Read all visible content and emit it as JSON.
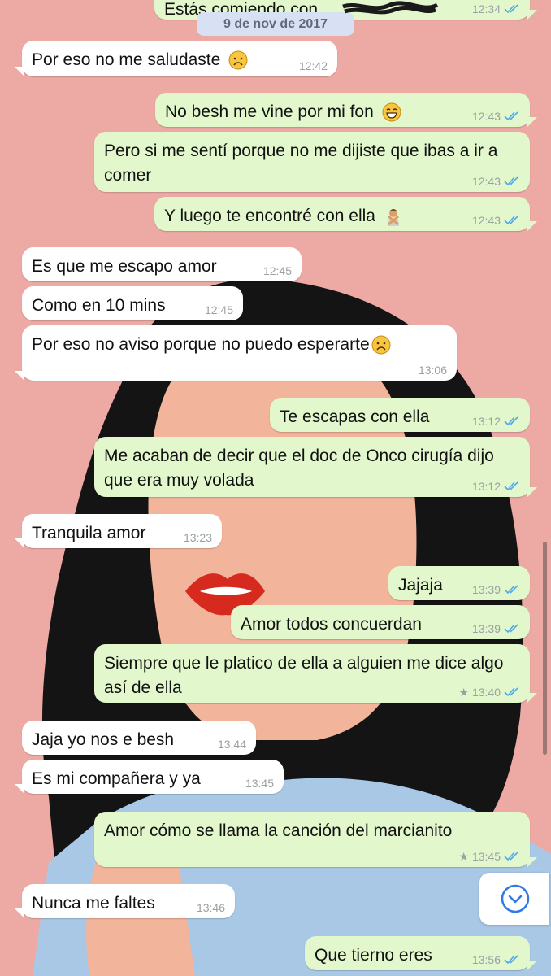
{
  "chat": {
    "date_label": "9 de nov de 2017",
    "messages": [
      {
        "dir": "out",
        "text": "Estás comiendo con",
        "time": "12:34",
        "status": "read"
      },
      {
        "dir": "in",
        "text": "Por eso no me saludaste",
        "emoji": "frowning-face",
        "time": "12:42"
      },
      {
        "dir": "out",
        "text": "No besh me vine por mi fon",
        "emoji": "grinning-face",
        "time": "12:43",
        "status": "read"
      },
      {
        "dir": "out",
        "text": "Pero si me sentí porque no me dijiste que ibas a ir a comer",
        "time": "12:43",
        "status": "read"
      },
      {
        "dir": "out",
        "text": "Y luego te encontré con ella",
        "emoji": "person-gesturing-no",
        "time": "12:43",
        "status": "read"
      },
      {
        "dir": "in",
        "text": "Es que me escapo amor",
        "time": "12:45"
      },
      {
        "dir": "in",
        "text": "Como en 10 mins",
        "time": "12:45"
      },
      {
        "dir": "in",
        "text": "Por eso no aviso porque no puedo esperarte",
        "emoji": "frowning-face",
        "time": "13:06"
      },
      {
        "dir": "out",
        "text": "Te escapas con ella",
        "time": "13:12",
        "status": "read"
      },
      {
        "dir": "out",
        "text": "Me acaban de decir que el doc de Onco cirugía dijo que era muy volada",
        "time": "13:12",
        "status": "read"
      },
      {
        "dir": "in",
        "text": "Tranquila amor",
        "time": "13:23"
      },
      {
        "dir": "out",
        "text": "Jajaja",
        "time": "13:39",
        "status": "read"
      },
      {
        "dir": "out",
        "text": "Amor todos concuerdan",
        "time": "13:39",
        "status": "read"
      },
      {
        "dir": "out",
        "text": "Siempre que le platico de ella a alguien me dice algo así de ella",
        "time": "13:40",
        "status": "read",
        "starred": true
      },
      {
        "dir": "in",
        "text": "Jaja yo nos e besh",
        "time": "13:44"
      },
      {
        "dir": "in",
        "text": "Es mi compañera y ya",
        "time": "13:45"
      },
      {
        "dir": "out",
        "text": "Amor cómo se llama la canción del marcianito",
        "time": "13:45",
        "status": "read",
        "starred": true
      },
      {
        "dir": "in",
        "text": "Nunca me faltes",
        "time": "13:46"
      },
      {
        "dir": "out",
        "text": "Que tierno eres",
        "time": "13:56",
        "status": "read"
      }
    ]
  },
  "icons": {
    "read_receipt": "double-check-icon",
    "star": "star-icon",
    "scroll_down": "chevron-down-icon"
  },
  "colors": {
    "incoming_bubble": "#ffffff",
    "outgoing_bubble": "#e2f7cb",
    "read_ticks": "#4fa8e8",
    "wallpaper": "#eda9a4"
  }
}
